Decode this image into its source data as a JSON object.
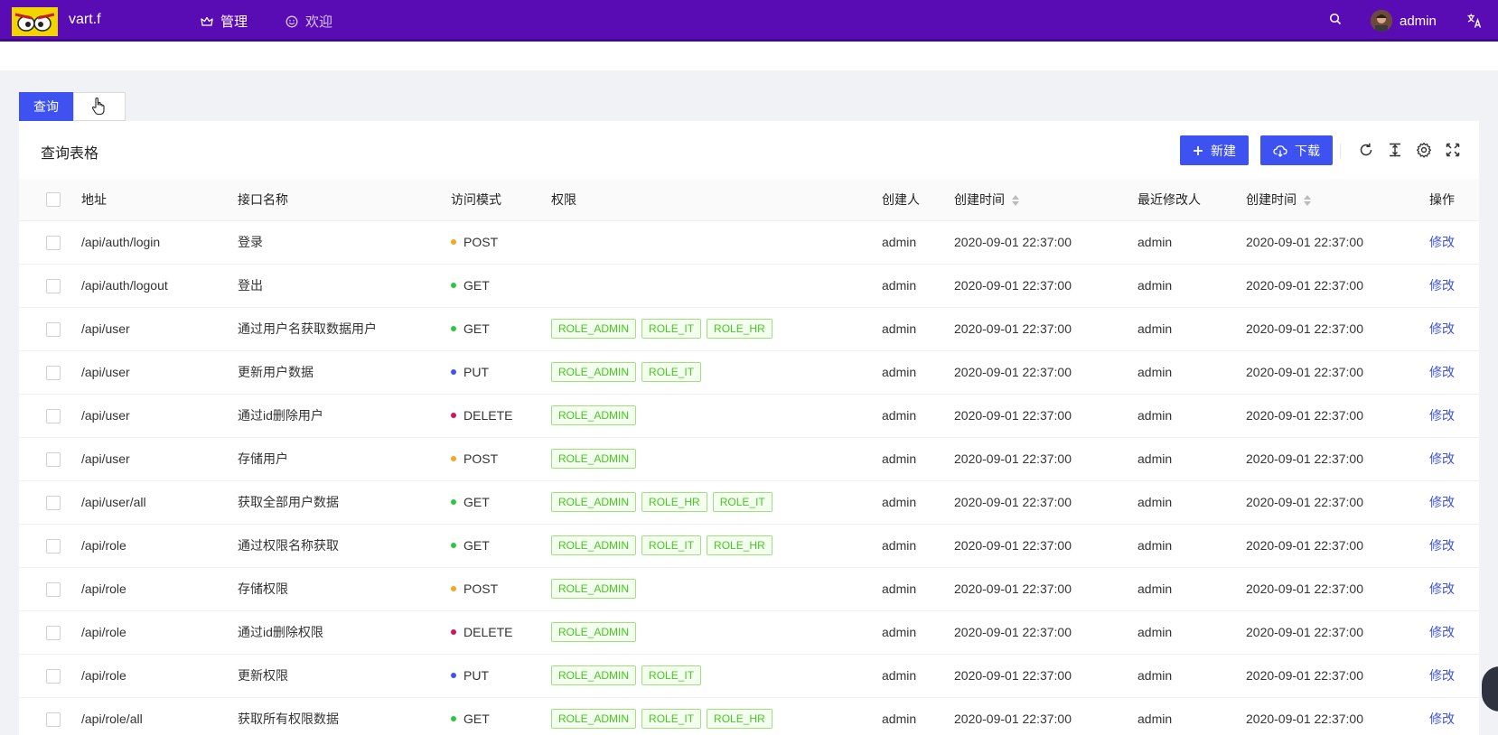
{
  "header": {
    "app_name": "vart.f",
    "nav": [
      {
        "label": "管理",
        "icon": "crown-icon"
      },
      {
        "label": "欢迎",
        "icon": "smile-icon"
      }
    ],
    "username": "admin"
  },
  "tabs": [
    {
      "label": "查询",
      "active": true
    },
    {
      "label": "",
      "active": false
    }
  ],
  "card": {
    "title": "查询表格",
    "new_label": "新建",
    "download_label": "下载"
  },
  "table": {
    "columns": [
      "地址",
      "接口名称",
      "访问模式",
      "权限",
      "创建人",
      "创建时间",
      "最近修改人",
      "创建时间",
      "操作"
    ],
    "action_label": "修改",
    "method_colors": {
      "POST": "#f5a623",
      "GET": "#27c93f",
      "PUT": "#3d52f0",
      "DELETE": "#d4145a"
    },
    "rows": [
      {
        "path": "/api/auth/login",
        "name": "登录",
        "method": "POST",
        "roles": [],
        "creator": "admin",
        "created": "2020-09-01 22:37:00",
        "modifier": "admin",
        "modified": "2020-09-01 22:37:00"
      },
      {
        "path": "/api/auth/logout",
        "name": "登出",
        "method": "GET",
        "roles": [],
        "creator": "admin",
        "created": "2020-09-01 22:37:00",
        "modifier": "admin",
        "modified": "2020-09-01 22:37:00"
      },
      {
        "path": "/api/user",
        "name": "通过用户名获取数据用户",
        "method": "GET",
        "roles": [
          "ROLE_ADMIN",
          "ROLE_IT",
          "ROLE_HR"
        ],
        "creator": "admin",
        "created": "2020-09-01 22:37:00",
        "modifier": "admin",
        "modified": "2020-09-01 22:37:00"
      },
      {
        "path": "/api/user",
        "name": "更新用户数据",
        "method": "PUT",
        "roles": [
          "ROLE_ADMIN",
          "ROLE_IT"
        ],
        "creator": "admin",
        "created": "2020-09-01 22:37:00",
        "modifier": "admin",
        "modified": "2020-09-01 22:37:00"
      },
      {
        "path": "/api/user",
        "name": "通过id删除用户",
        "method": "DELETE",
        "roles": [
          "ROLE_ADMIN"
        ],
        "creator": "admin",
        "created": "2020-09-01 22:37:00",
        "modifier": "admin",
        "modified": "2020-09-01 22:37:00"
      },
      {
        "path": "/api/user",
        "name": "存储用户",
        "method": "POST",
        "roles": [
          "ROLE_ADMIN"
        ],
        "creator": "admin",
        "created": "2020-09-01 22:37:00",
        "modifier": "admin",
        "modified": "2020-09-01 22:37:00"
      },
      {
        "path": "/api/user/all",
        "name": "获取全部用户数据",
        "method": "GET",
        "roles": [
          "ROLE_ADMIN",
          "ROLE_HR",
          "ROLE_IT"
        ],
        "creator": "admin",
        "created": "2020-09-01 22:37:00",
        "modifier": "admin",
        "modified": "2020-09-01 22:37:00"
      },
      {
        "path": "/api/role",
        "name": "通过权限名称获取",
        "method": "GET",
        "roles": [
          "ROLE_ADMIN",
          "ROLE_IT",
          "ROLE_HR"
        ],
        "creator": "admin",
        "created": "2020-09-01 22:37:00",
        "modifier": "admin",
        "modified": "2020-09-01 22:37:00"
      },
      {
        "path": "/api/role",
        "name": "存储权限",
        "method": "POST",
        "roles": [
          "ROLE_ADMIN"
        ],
        "creator": "admin",
        "created": "2020-09-01 22:37:00",
        "modifier": "admin",
        "modified": "2020-09-01 22:37:00"
      },
      {
        "path": "/api/role",
        "name": "通过id删除权限",
        "method": "DELETE",
        "roles": [
          "ROLE_ADMIN"
        ],
        "creator": "admin",
        "created": "2020-09-01 22:37:00",
        "modifier": "admin",
        "modified": "2020-09-01 22:37:00"
      },
      {
        "path": "/api/role",
        "name": "更新权限",
        "method": "PUT",
        "roles": [
          "ROLE_ADMIN",
          "ROLE_IT"
        ],
        "creator": "admin",
        "created": "2020-09-01 22:37:00",
        "modifier": "admin",
        "modified": "2020-09-01 22:37:00"
      },
      {
        "path": "/api/role/all",
        "name": "获取所有权限数据",
        "method": "GET",
        "roles": [
          "ROLE_ADMIN",
          "ROLE_IT",
          "ROLE_HR"
        ],
        "creator": "admin",
        "created": "2020-09-01 22:37:00",
        "modifier": "admin",
        "modified": "2020-09-01 22:37:00"
      }
    ]
  },
  "colors": {
    "topbar": "#5a0cb4",
    "primary": "#3d52f0",
    "tag_green": "#43c91f"
  }
}
